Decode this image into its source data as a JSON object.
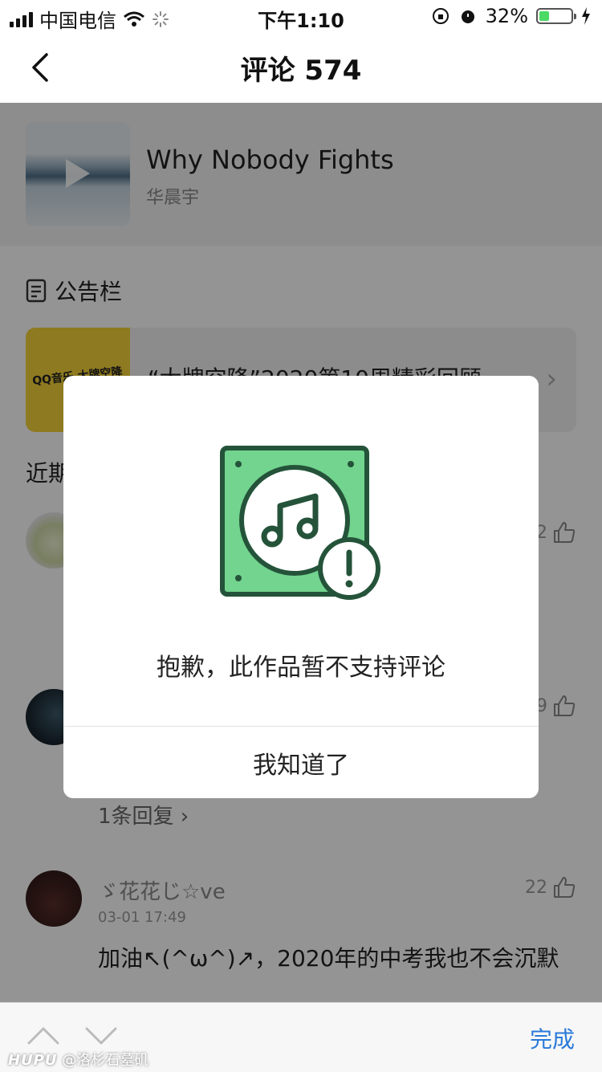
{
  "status_bar": {
    "carrier": "中国电信",
    "time": "下午1:10",
    "battery_percent": "32%",
    "battery_level": 0.32,
    "battery_color": "#4cd964"
  },
  "nav": {
    "back_icon": "chevron-left-icon",
    "title": "评论 574"
  },
  "song": {
    "title": "Why Nobody Fights",
    "artist": "华晨宇"
  },
  "announcement": {
    "heading": "公告栏",
    "image_text": "QQ音乐 大牌空降",
    "text": "“大牌空降”2020第10周精彩回顾"
  },
  "recent_heading": "近期",
  "comments": [
    {
      "likes": "2"
    },
    {
      "likes": "9",
      "replies": "1条回复"
    },
    {
      "name": "ゞ花花じ☆ve",
      "time": "03-01 17:49",
      "likes": "22",
      "text": "加油↖(^ω^)↗，2020年的中考我也不会沉默"
    }
  ],
  "dialog": {
    "icon": "music-file-warning-icon",
    "message": "抱歉，此作品暂不支持评论",
    "button": "我知道了",
    "icon_green": "#72d48e",
    "icon_stroke": "#24533a"
  },
  "keyboard_bar": {
    "done": "完成"
  },
  "watermark": {
    "brand": "HUPU",
    "handle": "@洛杉石墓矶"
  }
}
